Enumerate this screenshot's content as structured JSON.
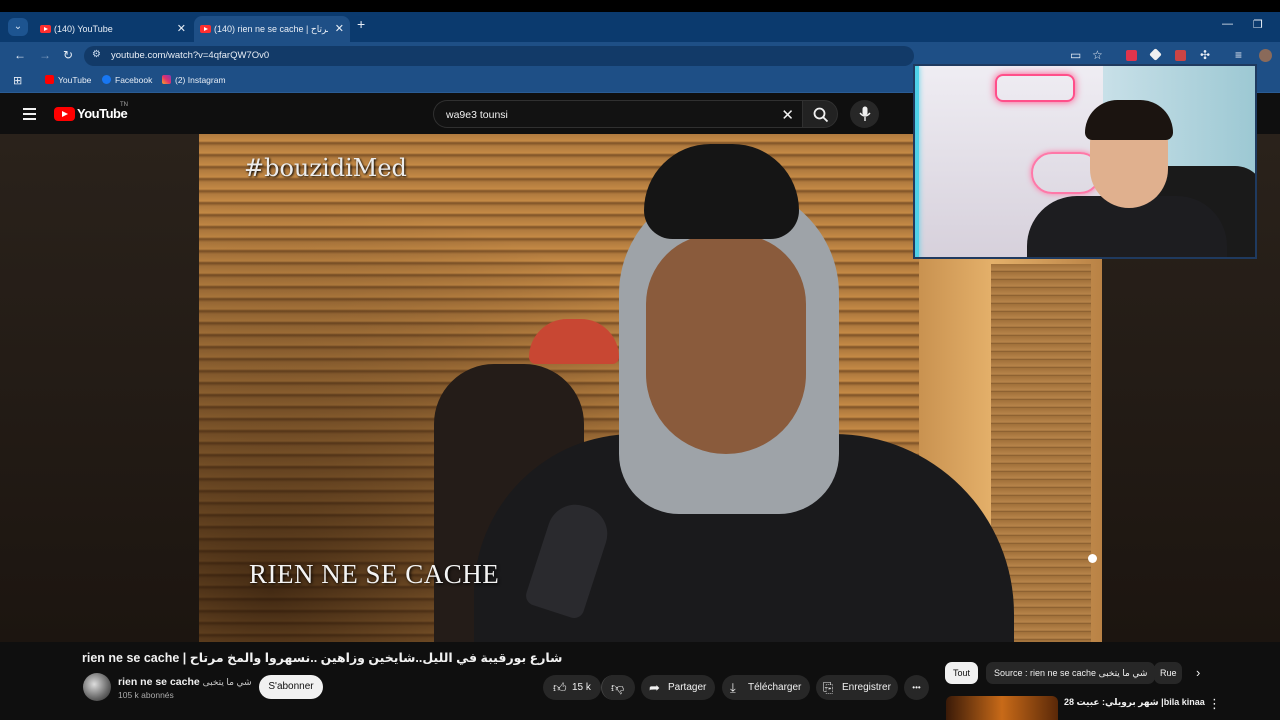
{
  "browser": {
    "tabs": [
      {
        "label": "(140) YouTube"
      },
      {
        "label": "(140) rien ne se cache | شارع بورقيبة في الليل..شايخين وزاهين ..نسهروا والمخ مرتاح"
      }
    ],
    "new_tab": "+",
    "url": "youtube.com/watch?v=4qfarQW7Ov0",
    "bookmarks": [
      {
        "label": "YouTube"
      },
      {
        "label": "Facebook"
      },
      {
        "label": "(2) Instagram"
      }
    ]
  },
  "masthead": {
    "logo_text": "YouTube",
    "region": "TN",
    "search_query": "wa9e3 tounsi"
  },
  "video": {
    "watermark_hashtag": "#bouzidiMed",
    "watermark_caption": "RIEN NE SE CACHE"
  },
  "details": {
    "title": "rien ne se cache | شارع بورقيبة في الليل..شايخين وزاهين ..نسهروا والمخ مرتاح",
    "channel_name": "rien ne se cache",
    "channel_name_ar": "شي ما يتخبى",
    "subscribers": "105 k abonnés",
    "subscribe_label": "S'abonner",
    "likes": "15 k",
    "share_label": "Partager",
    "download_label": "Télécharger",
    "save_label": "Enregistrer",
    "more_label": "•••"
  },
  "chips": [
    {
      "label": "Tout"
    },
    {
      "label": "Source : rien ne se cache شي ما يتخبى"
    },
    {
      "label": "Rue"
    }
  ],
  "recommendation": {
    "title": "28 شهر برويلي: عبيت |bila kinaa"
  },
  "colors": {
    "yt_red": "#ff0000",
    "chrome_blue": "#1e4f86",
    "background": "#0f0f0f"
  }
}
